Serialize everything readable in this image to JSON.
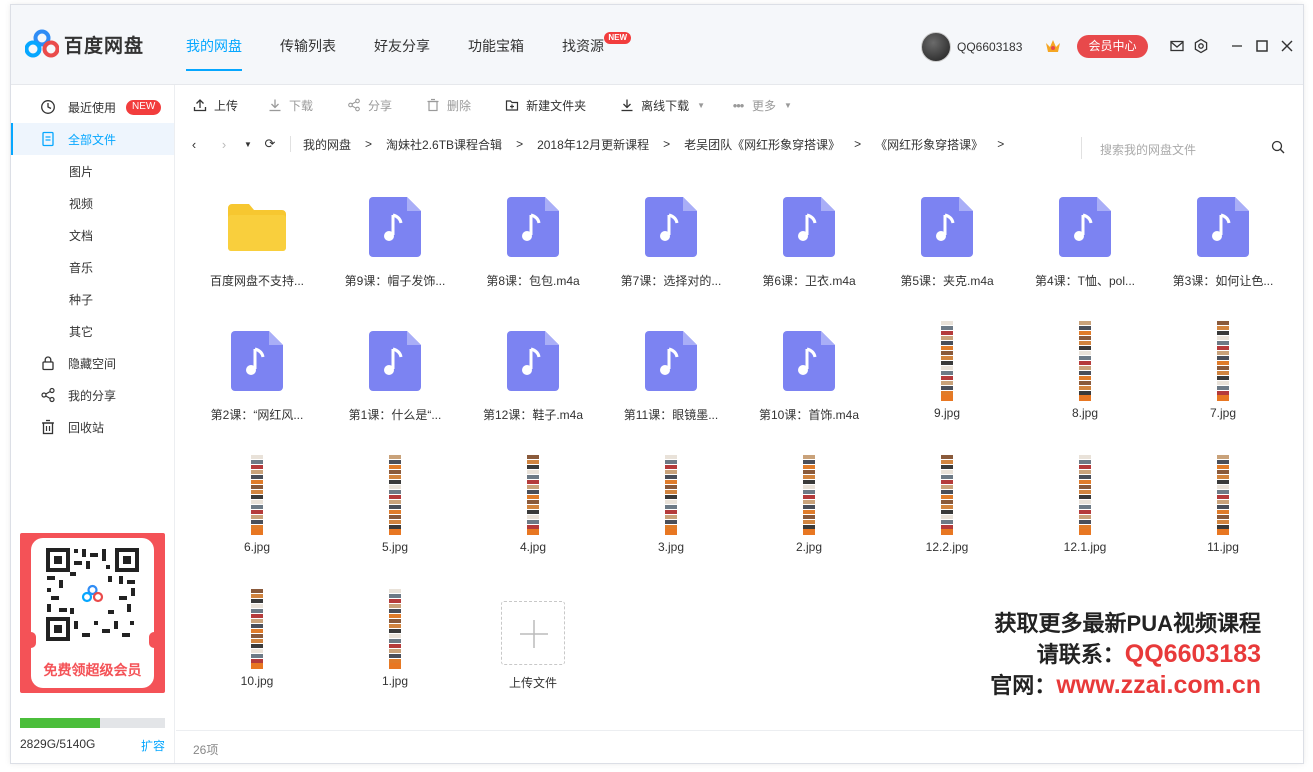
{
  "app": {
    "logo_text": "百度网盘"
  },
  "nav": [
    {
      "label": "我的网盘",
      "active": true
    },
    {
      "label": "传输列表"
    },
    {
      "label": "好友分享"
    },
    {
      "label": "功能宝箱"
    },
    {
      "label": "找资源",
      "badge": "NEW"
    }
  ],
  "user": {
    "name": "QQ6603183",
    "vip_button": "会员中心"
  },
  "sidebar": {
    "items": [
      {
        "label": "最近使用",
        "badge": "NEW",
        "icon": "clock-icon"
      },
      {
        "label": "全部文件",
        "icon": "document-icon",
        "active": true
      },
      {
        "label": "图片"
      },
      {
        "label": "视频"
      },
      {
        "label": "文档"
      },
      {
        "label": "音乐"
      },
      {
        "label": "种子"
      },
      {
        "label": "其它"
      },
      {
        "label": "隐藏空间",
        "icon": "lock-icon"
      },
      {
        "label": "我的分享",
        "icon": "share-icon"
      },
      {
        "label": "回收站",
        "icon": "trash-icon"
      }
    ],
    "promo_text": "免费领超级会员",
    "storage_text": "2829G/5140G",
    "storage_used_fraction": 0.55,
    "expand_label": "扩容"
  },
  "toolbar": {
    "upload": "上传",
    "download": "下载",
    "share": "分享",
    "delete": "删除",
    "new_folder": "新建文件夹",
    "offline_download": "离线下载",
    "more": "更多"
  },
  "path": {
    "crumbs": [
      "我的网盘",
      "淘妹社2.6TB课程合辑",
      "2018年12月更新课程",
      "老吴团队《网红形象穿搭课》",
      "《网红形象穿搭课》"
    ],
    "search_placeholder": "搜索我的网盘文件"
  },
  "files": [
    {
      "name": "百度网盘不支持...",
      "type": "folder"
    },
    {
      "name": "第9课：帽子发饰...",
      "type": "audio"
    },
    {
      "name": "第8课：包包.m4a",
      "type": "audio"
    },
    {
      "name": "第7课：选择对的...",
      "type": "audio"
    },
    {
      "name": "第6课：卫衣.m4a",
      "type": "audio"
    },
    {
      "name": "第5课：夹克.m4a",
      "type": "audio"
    },
    {
      "name": "第4课：T恤、pol...",
      "type": "audio"
    },
    {
      "name": "第3课：如何让色...",
      "type": "audio"
    },
    {
      "name": "第2课：“网红风...",
      "type": "audio"
    },
    {
      "name": "第1课：什么是“...",
      "type": "audio"
    },
    {
      "name": "第12课：鞋子.m4a",
      "type": "audio"
    },
    {
      "name": "第11课：眼镜墨...",
      "type": "audio"
    },
    {
      "name": "第10课：首饰.m4a",
      "type": "audio"
    },
    {
      "name": "9.jpg",
      "type": "image"
    },
    {
      "name": "8.jpg",
      "type": "image"
    },
    {
      "name": "7.jpg",
      "type": "image"
    },
    {
      "name": "6.jpg",
      "type": "image"
    },
    {
      "name": "5.jpg",
      "type": "image"
    },
    {
      "name": "4.jpg",
      "type": "image"
    },
    {
      "name": "3.jpg",
      "type": "image"
    },
    {
      "name": "2.jpg",
      "type": "image"
    },
    {
      "name": "12.2.jpg",
      "type": "image"
    },
    {
      "name": "12.1.jpg",
      "type": "image"
    },
    {
      "name": "11.jpg",
      "type": "image"
    },
    {
      "name": "10.jpg",
      "type": "image"
    },
    {
      "name": "1.jpg",
      "type": "image"
    },
    {
      "name": "上传文件",
      "type": "upload"
    }
  ],
  "watermark": {
    "line1": "获取更多最新PUA视频课程",
    "line2_prefix": "请联系：",
    "line2_value": "QQ6603183",
    "line3_prefix": "官网：",
    "line3_value": "www.zzai.com.cn"
  },
  "footer": {
    "count": "26项"
  },
  "colors": {
    "accent": "#06a7ff",
    "audio_icon": "#7c83f2",
    "folder": "#f7c730",
    "vip": "#e8494b",
    "storage": "#4bbe3b"
  }
}
